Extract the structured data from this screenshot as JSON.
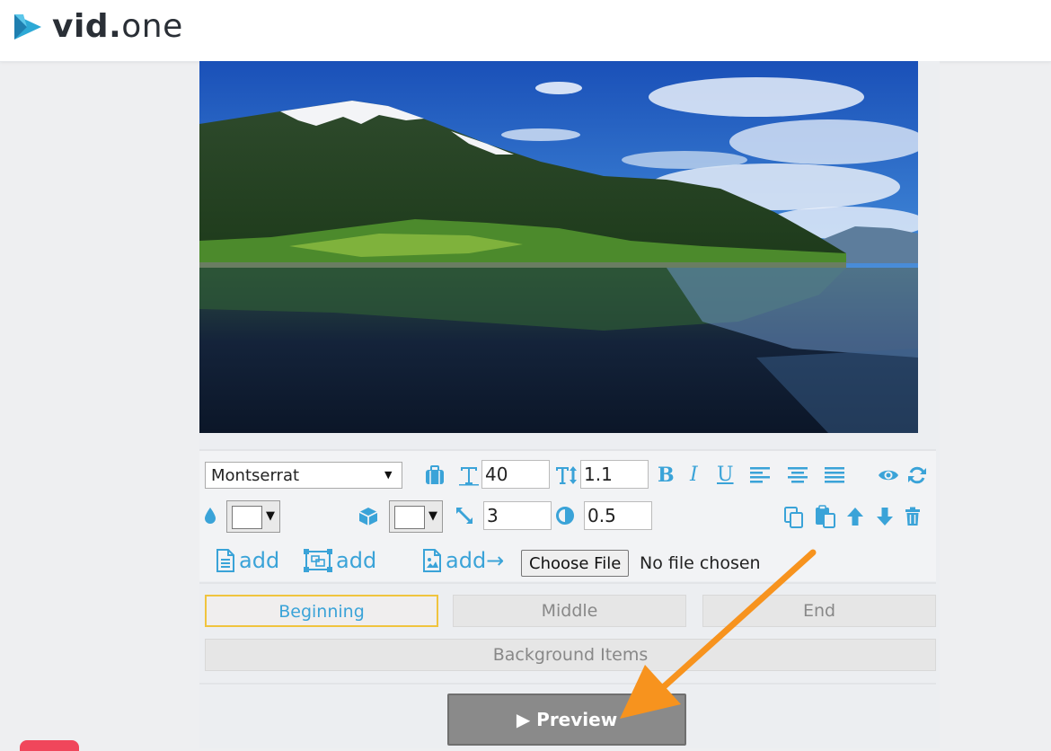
{
  "brand": {
    "name_bold": "vid",
    "name_dot": ".",
    "name_light": "one"
  },
  "toolbar": {
    "font": {
      "selected": "Montserrat"
    },
    "font_size": "40",
    "line_height": "1.1",
    "border_width": "3",
    "opacity": "0.5"
  },
  "add_row": {
    "add_text_label": "add",
    "add_shape_label": "add",
    "add_image_label": "add→",
    "file_button": "Choose File",
    "file_status": "No file chosen"
  },
  "tabs": {
    "beginning": "Beginning",
    "middle": "Middle",
    "end": "End",
    "background": "Background Items"
  },
  "preview": {
    "label": "▶ Preview"
  },
  "colors": {
    "accent": "#3aa3d8",
    "active_border": "#f0c43e",
    "annotation_arrow": "#f7931e",
    "preview_bg": "#8a8a8a"
  }
}
